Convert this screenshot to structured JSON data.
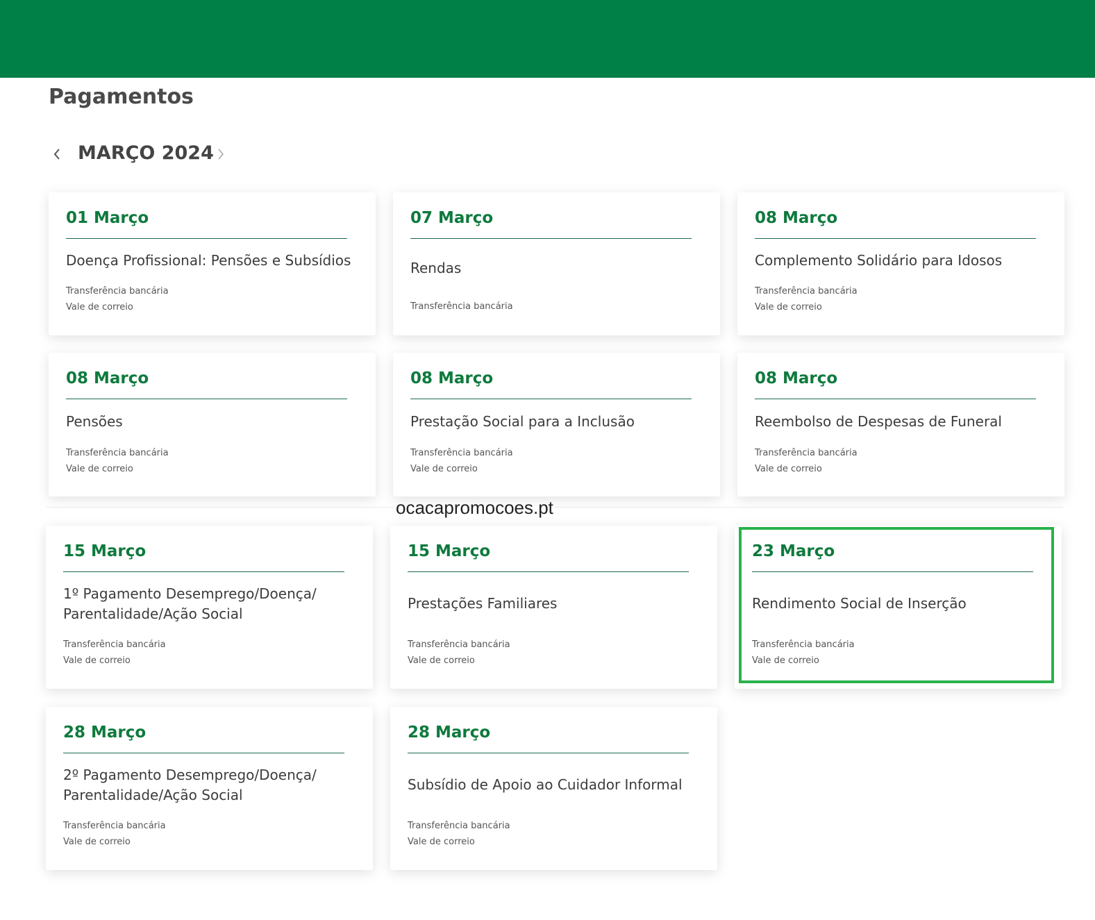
{
  "page": {
    "title": "Pagamentos",
    "month_label": "MARÇO 2024",
    "watermark": "ocacapromocoes.pt",
    "accent_color": "#008046",
    "highlight_color": "#2ab24d"
  },
  "nav": {
    "prev_icon": "chevron-left-icon",
    "next_icon": "chevron-right-icon"
  },
  "cards": [
    {
      "date": "01 Março",
      "title": "Doença Profissional: Pensões e Subsídios",
      "methods": [
        "Transferência bancária",
        "Vale de correio"
      ]
    },
    {
      "date": "07 Março",
      "title": "Rendas",
      "methods": [
        "Transferência bancária"
      ]
    },
    {
      "date": "08 Março",
      "title": "Complemento Solidário para Idosos",
      "methods": [
        "Transferência bancária",
        "Vale de correio"
      ]
    },
    {
      "date": "08 Março",
      "title": "Pensões",
      "methods": [
        "Transferência bancária",
        "Vale de correio"
      ]
    },
    {
      "date": "08 Março",
      "title": "Prestação Social para a Inclusão",
      "methods": [
        "Transferência bancária",
        "Vale de correio"
      ]
    },
    {
      "date": "08 Março",
      "title": "Reembolso de Despesas de Funeral",
      "methods": [
        "Transferência bancária",
        "Vale de correio"
      ]
    },
    {
      "date": "15 Março",
      "title": "1º Pagamento Desemprego/Doença/ Parentalidade/Ação Social",
      "methods": [
        "Transferência bancária",
        "Vale de correio"
      ]
    },
    {
      "date": "15 Março",
      "title": "Prestações Familiares",
      "methods": [
        "Transferência bancária",
        "Vale de correio"
      ]
    },
    {
      "date": "23 Março",
      "title": "Rendimento Social de Inserção",
      "methods": [
        "Transferência bancária",
        "Vale de correio"
      ],
      "highlighted": true
    },
    {
      "date": "28 Março",
      "title": "2º Pagamento Desemprego/Doença/ Parentalidade/Ação Social",
      "methods": [
        "Transferência bancária",
        "Vale de correio"
      ]
    },
    {
      "date": "28 Março",
      "title": "Subsídio de Apoio ao Cuidador Informal",
      "methods": [
        "Transferência bancária",
        "Vale de correio"
      ]
    }
  ]
}
